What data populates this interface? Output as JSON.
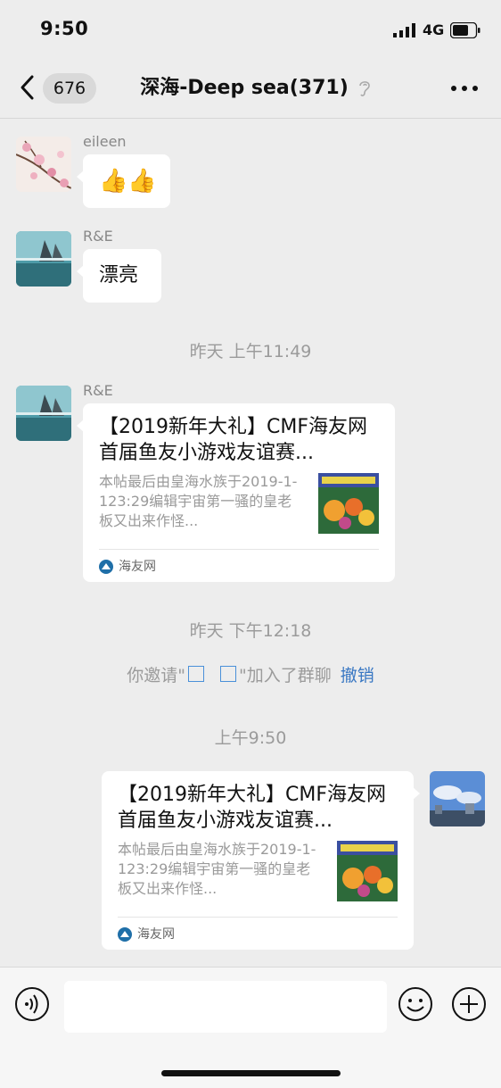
{
  "status": {
    "time": "9:50",
    "network": "4G"
  },
  "nav": {
    "badge_count": "676",
    "title": "深海-Deep sea(371)"
  },
  "messages": {
    "m1": {
      "sender": "eileen",
      "text": "👍👍"
    },
    "m2": {
      "sender": "R&E",
      "text": "漂亮"
    },
    "ts1": "昨天 上午11:49",
    "m3": {
      "sender": "R&E",
      "card_title": "【2019新年大礼】CMF海友网首届鱼友小游戏友谊赛...",
      "card_desc": "本帖最后由皇海水族于2019-1-123:29编辑宇宙第一骚的皇老板又出来作怪...",
      "card_source": "海友网"
    },
    "ts2": "昨天 下午12:18",
    "system": {
      "prefix": "你邀请\"",
      "suffix": "\"加入了群聊",
      "revoke": "撤销"
    },
    "ts3": "上午9:50",
    "m4": {
      "card_title": "【2019新年大礼】CMF海友网首届鱼友小游戏友谊赛...",
      "card_desc": "本帖最后由皇海水族于2019-1-123:29编辑宇宙第一骚的皇老板又出来作怪...",
      "card_source": "海友网"
    }
  },
  "colors": {
    "background": "#ededed",
    "bubble": "#ffffff",
    "link": "#3a78c3",
    "timestamp": "#9b9b9b"
  },
  "icons": [
    "back-chevron-icon",
    "ear-icon",
    "more-icon",
    "voice-icon",
    "emoji-icon",
    "plus-icon"
  ]
}
